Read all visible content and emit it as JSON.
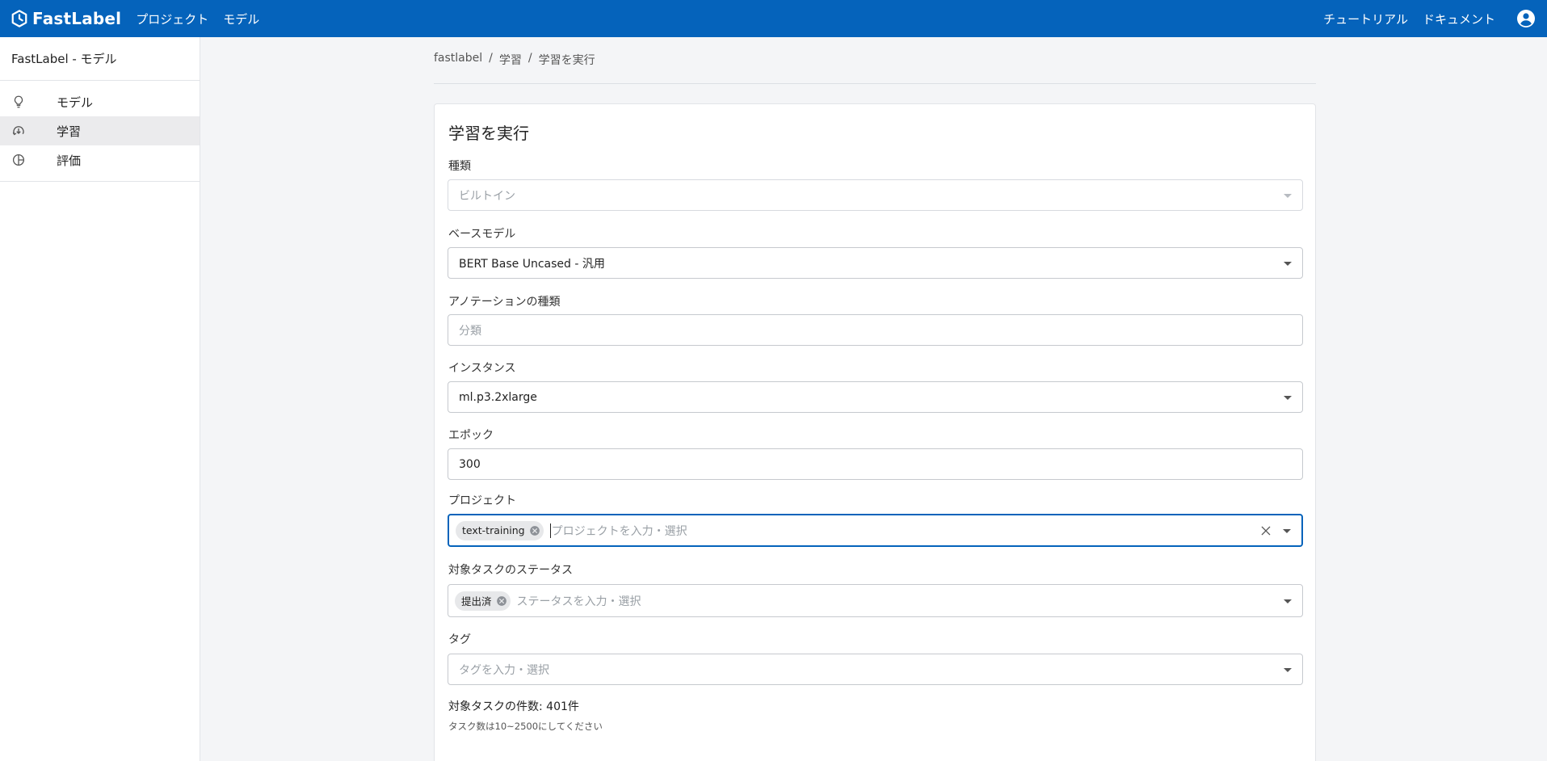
{
  "header": {
    "logo_text": "FastLabel",
    "nav": [
      "プロジェクト",
      "モデル"
    ],
    "right_links": [
      "チュートリアル",
      "ドキュメント"
    ],
    "brand_color": "#0563bb"
  },
  "sidebar": {
    "title": "FastLabel - モデル",
    "items": [
      {
        "label": "モデル",
        "icon": "lightbulb-icon",
        "active": false
      },
      {
        "label": "学習",
        "icon": "training-icon",
        "active": true
      },
      {
        "label": "評価",
        "icon": "pie-chart-icon",
        "active": false
      }
    ]
  },
  "breadcrumb": [
    "fastlabel",
    "/",
    "学習",
    "/",
    "学習を実行"
  ],
  "form": {
    "title": "学習を実行",
    "type": {
      "label": "種類",
      "value": "ビルトイン"
    },
    "base_model": {
      "label": "ベースモデル",
      "value": "BERT Base Uncased - 汎用"
    },
    "annotation_type": {
      "label": "アノテーションの種類",
      "placeholder": "分類"
    },
    "instance": {
      "label": "インスタンス",
      "value": "ml.p3.2xlarge"
    },
    "epoch": {
      "label": "エポック",
      "value": "300"
    },
    "project": {
      "label": "プロジェクト",
      "chips": [
        "text-training"
      ],
      "placeholder": "プロジェクトを入力・選択"
    },
    "status": {
      "label": "対象タスクのステータス",
      "chips": [
        "提出済"
      ],
      "placeholder": "ステータスを入力・選択"
    },
    "tags": {
      "label": "タグ",
      "placeholder": "タグを入力・選択"
    },
    "task_count": "対象タスクの件数: 401件",
    "task_hint": "タスク数は10~2500にしてください"
  }
}
